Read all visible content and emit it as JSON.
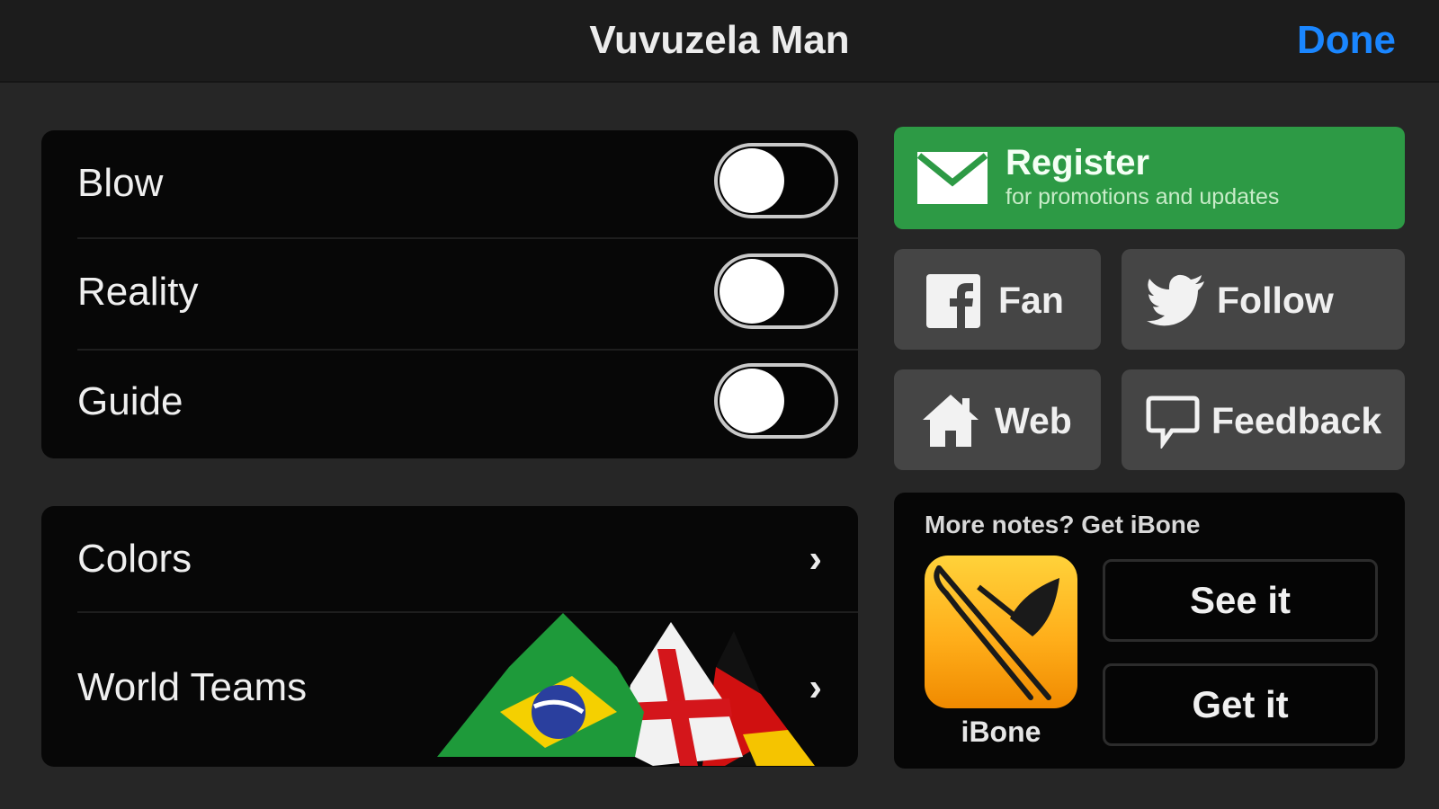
{
  "navbar": {
    "title": "Vuvuzela Man",
    "done_label": "Done"
  },
  "settings": {
    "toggles": [
      {
        "label": "Blow",
        "on": false
      },
      {
        "label": "Reality",
        "on": false
      },
      {
        "label": "Guide",
        "on": false
      }
    ],
    "links": [
      {
        "label": "Colors"
      },
      {
        "label": "World Teams"
      }
    ]
  },
  "register": {
    "title": "Register",
    "subtitle": "for promotions and updates"
  },
  "social": {
    "fan_label": "Fan",
    "follow_label": "Follow",
    "web_label": "Web",
    "feedback_label": "Feedback"
  },
  "promo": {
    "title": "More notes?  Get iBone",
    "app_name": "iBone",
    "see_label": "See it",
    "get_label": "Get it"
  },
  "colors": {
    "accent": "#1a86ff",
    "register_green": "#2d9a45",
    "tile_gray": "#454545"
  },
  "icons": {
    "register": "mail-icon",
    "fan": "facebook-icon",
    "follow": "twitter-icon",
    "web": "home-icon",
    "feedback": "speech-bubble-icon",
    "disclosure": "chevron-right-icon"
  }
}
